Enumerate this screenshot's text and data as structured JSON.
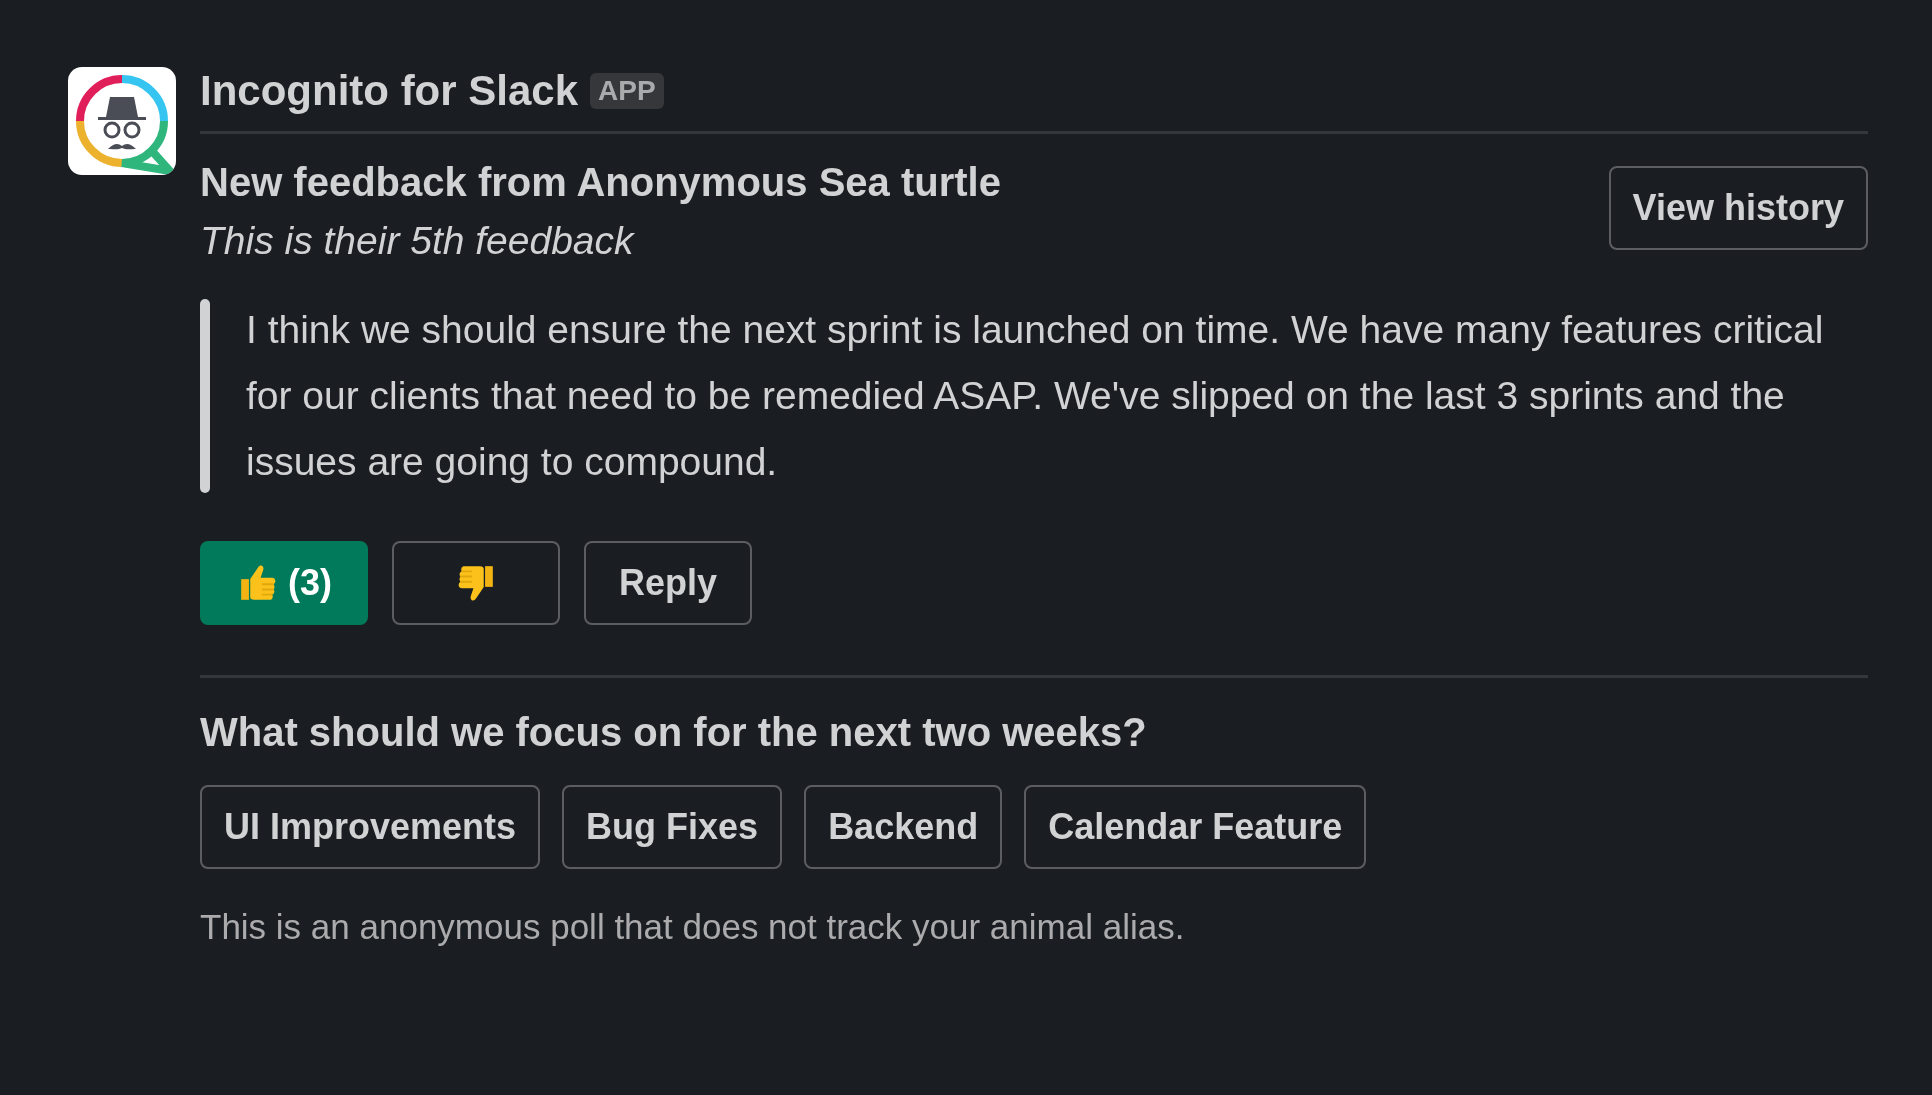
{
  "app": {
    "name": "Incognito for Slack",
    "badge": "APP"
  },
  "message": {
    "title": "New feedback from Anonymous Sea turtle",
    "subtitle": "This is their 5th feedback",
    "view_history": "View history",
    "quote": "I think we should ensure the next sprint is launched on time. We have many features critical for our clients that need to be remedied ASAP.  We've slipped on the last 3 sprints and the issues are going to compound.",
    "actions": [
      {
        "kind": "upvote",
        "count": "(3)",
        "selected": true
      },
      {
        "kind": "downvote",
        "selected": false
      },
      {
        "kind": "text",
        "label": "Reply",
        "selected": false
      }
    ]
  },
  "poll": {
    "question": "What should we focus on for the next two weeks?",
    "options": [
      "UI Improvements",
      "Bug Fixes",
      "Backend",
      "Calendar Feature"
    ],
    "note": "This is an anonymous poll that does not track your animal alias."
  }
}
